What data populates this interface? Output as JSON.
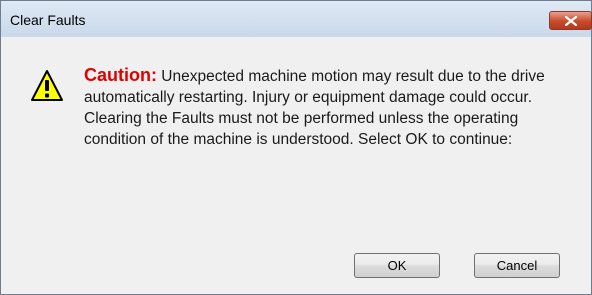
{
  "window": {
    "title": "Clear Faults"
  },
  "message": {
    "label": "Caution:",
    "body": " Unexpected machine motion may result due to the drive automatically restarting.  Injury or equipment damage could occur.  Clearing the Faults must not be performed unless the operating condition of the machine is understood. Select OK to continue:"
  },
  "buttons": {
    "ok_label": "OK",
    "cancel_label": "Cancel"
  },
  "icons": {
    "warning": "warning-icon",
    "close": "close-icon"
  },
  "colors": {
    "caution_label": "#e00000",
    "warning_fill": "#ffff00",
    "close_button": "#c84a2c"
  }
}
